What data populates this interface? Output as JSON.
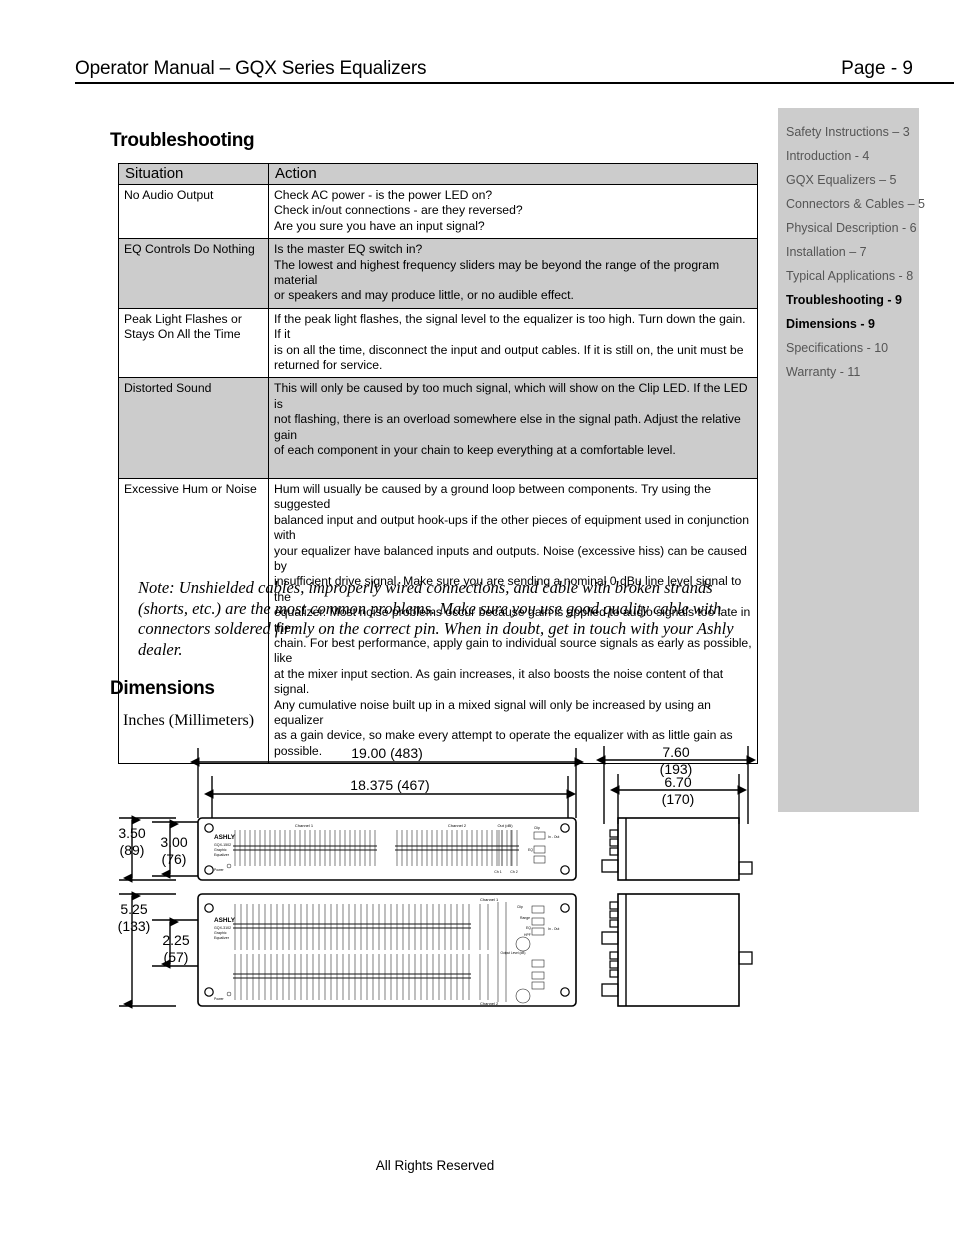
{
  "header": {
    "title": "Operator Manual – GQX Series Equalizers",
    "page_label": "Page - 9"
  },
  "sections": {
    "troubleshooting_title": "Troubleshooting",
    "dimensions_title": "Dimensions",
    "dimensions_caption": "Inches (Millimeters)"
  },
  "trouble_table": {
    "columns": [
      "Situation",
      "Action"
    ],
    "rows": [
      {
        "situation": "No Audio Output",
        "action": [
          "Check AC power - is the power LED on?",
          "Check in/out connections - are they reversed?",
          "Are you sure you have an input signal?"
        ]
      },
      {
        "situation": "EQ Controls Do Nothing",
        "action": [
          "Is the master EQ switch in?",
          "The lowest and highest frequency sliders may be beyond the range of the program material",
          "or speakers and may produce little, or no audible effect."
        ]
      },
      {
        "situation": "Peak Light Flashes or Stays On All the Time",
        "action": [
          "If the peak light flashes, the signal level to the equalizer is too high. Turn down the gain. If it",
          "is on all the time, disconnect the input and output cables. If it is still on, the unit must be",
          "returned for service."
        ]
      },
      {
        "situation": "Distorted Sound",
        "action": [
          "This will only be caused by too much signal, which will show on the Clip LED. If the LED is",
          "not flashing, there is an overload somewhere else in the signal path. Adjust the relative gain",
          "of each component in your chain to keep everything at a comfortable level."
        ]
      },
      {
        "situation": "Excessive Hum or Noise",
        "action": [
          "Hum will usually be caused by a ground loop between components. Try using the suggested",
          "balanced input and output hook-ups if the other pieces of equipment used in conjunction with",
          "your equalizer have balanced inputs and outputs. Noise (excessive hiss) can be caused by",
          "insufficient drive signal. Make sure you are sending a nominal 0 dBu line level signal to the",
          "equalizer.  Most noise problems occur because gain is applied to audio signals too late in the",
          "chain. For best performance, apply gain to individual source signals as early as possible, like",
          "at the mixer input section. As gain increases, it also boosts the noise content of that signal.",
          "Any cumulative noise built up in a mixed signal will only be increased by using an equalizer",
          "as a gain device, so make every attempt to operate the equalizer with as little gain as",
          "possible."
        ]
      }
    ]
  },
  "note": "Note: Unshielded cables, improperly wired connections, and cable with broken strands (shorts, etc.) are the most common problems. Make sure you use good quality cable with connectors soldered firmly on the correct pin. When in doubt, get in touch with your Ashly dealer.",
  "toc": {
    "items": [
      {
        "label": "Safety Instructions – 3",
        "current": false
      },
      {
        "label": "Introduction - 4",
        "current": false
      },
      {
        "label": "GQX Equalizers – 5",
        "current": false
      },
      {
        "label": "Connectors & Cables – 5",
        "current": false
      },
      {
        "label": "Physical Description - 6",
        "current": false
      },
      {
        "label": "Installation – 7",
        "current": false
      },
      {
        "label": "Typical Applications - 8",
        "current": false
      },
      {
        "label": "Troubleshooting - 9",
        "current": true
      },
      {
        "label": "Dimensions - 9",
        "current": true
      },
      {
        "label": "Specifications - 10",
        "current": false
      },
      {
        "label": "Warranty - 11",
        "current": false
      }
    ]
  },
  "diagram": {
    "dimensions": {
      "front_overall_width": "19.00 (483)",
      "front_panel_width": "18.375 (467)",
      "top_unit_height_outer": "3.50",
      "top_unit_height_outer_mm": "(89)",
      "top_unit_height_inner": "3.00",
      "top_unit_height_inner_mm": "(76)",
      "bottom_unit_height_outer": "5.25",
      "bottom_unit_height_outer_mm": "(133)",
      "bottom_unit_height_inner": "2.25",
      "bottom_unit_height_inner_mm": "(57)",
      "side_depth_overall": "7.60",
      "side_depth_overall_mm": "(193)",
      "side_depth_chassis": "6.70",
      "side_depth_chassis_mm": "(170)"
    },
    "panel_labels": {
      "brand": "ASHLY",
      "model_top": "GQX-1502",
      "model_bottom": "GQX-3102",
      "product_line_1": "Graphic",
      "product_line_2": "Equalizer",
      "channel_1": "Channel 1",
      "channel_2": "Channel 2",
      "power": "Power",
      "out_db": "Out (dB)",
      "ch1": "Ch 1",
      "ch2": "Ch 2",
      "clip": "Clip",
      "eq": "EQ",
      "hpf": "HPF",
      "range": "Range",
      "in_out": "In - Out",
      "output_level": "Output Level (dB)"
    }
  },
  "footer": {
    "text": "All Rights Reserved"
  },
  "colors": {
    "sidebar_bg": "#cccccc",
    "table_shade": "#cccccc",
    "text": "#000000",
    "toc_inactive": "#555555"
  }
}
